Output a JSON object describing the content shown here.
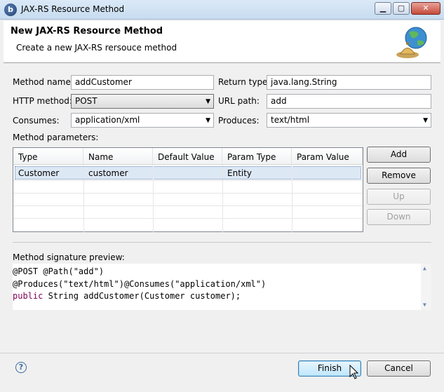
{
  "window": {
    "title": "JAX-RS Resource Method",
    "app_icon_letter": "b",
    "min_glyph": "▁",
    "max_glyph": "▢",
    "close_glyph": "✕"
  },
  "banner": {
    "title": "New JAX-RS Resource Method",
    "description": "Create a new JAX-RS rersouce method",
    "icon": "globe-bell-icon"
  },
  "form": {
    "method_name_label": "Method name:",
    "method_name_value": "addCustomer",
    "return_type_label": "Return type:",
    "return_type_value": "java.lang.String",
    "http_method_label": "HTTP method:",
    "http_method_value": "POST",
    "url_path_label": "URL path:",
    "url_path_value": "add",
    "consumes_label": "Consumes:",
    "consumes_value": "application/xml",
    "produces_label": "Produces:",
    "produces_value": "text/html"
  },
  "params": {
    "label": "Method parameters:",
    "columns": [
      "Type",
      "Name",
      "Default Value",
      "Param Type",
      "Param Value"
    ],
    "rows": [
      [
        "Customer",
        "customer",
        "",
        "Entity",
        ""
      ]
    ],
    "buttons": {
      "add": "Add",
      "remove": "Remove",
      "up": "Up",
      "down": "Down"
    }
  },
  "preview": {
    "label": "Method signature preview:",
    "line1": "@POST @Path(\"add\")",
    "line2": "@Produces(\"text/html\")@Consumes(\"application/xml\")",
    "line3_kw": "public",
    "line3_rest": " String addCustomer(Customer customer);"
  },
  "footer": {
    "help_glyph": "?",
    "finish_label": "Finish",
    "cancel_label": "Cancel"
  },
  "colors": {
    "keyword": "#7f0055",
    "selection": "#dde8f5"
  }
}
